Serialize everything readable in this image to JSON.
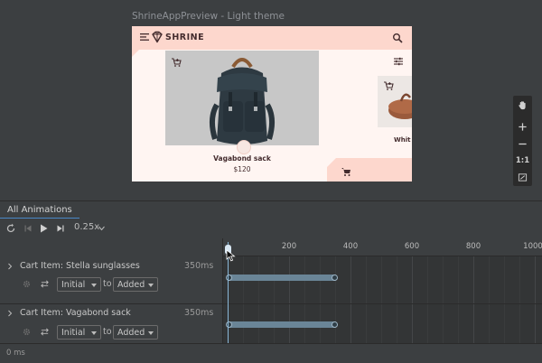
{
  "preview": {
    "title": "ShrineAppPreview - Light theme",
    "app": {
      "brand": "SHRINE",
      "icons": [
        "menu-icon",
        "shrine-logo-icon",
        "search-icon",
        "filter-icon",
        "add-shopping-cart-icon",
        "shopping-cart-icon"
      ],
      "products": [
        {
          "name": "Vagabond sack",
          "price": "$120"
        },
        {
          "name": "Whit"
        }
      ],
      "colors": {
        "appbar": "#fdd7cd",
        "surface": "#fff5f2",
        "text": "#442c2e"
      }
    },
    "toolbar": {
      "items": [
        "pan-icon",
        "zoom-in-icon",
        "zoom-out-icon",
        "1:1",
        "fit-screen-icon"
      ],
      "fit_label": "1:1"
    }
  },
  "tabs": [
    {
      "label": "All Animations",
      "selected": true
    }
  ],
  "controls": {
    "speed": "0.25x",
    "icons": [
      "replay-icon",
      "skip-start-icon",
      "play-icon",
      "skip-end-icon"
    ]
  },
  "timeline": {
    "ruler_labels": [
      "200",
      "400",
      "600",
      "800",
      "1000"
    ],
    "rows": [
      {
        "title": "Cart Item: Stella sunglasses",
        "duration": "350ms",
        "from": "Initial",
        "to_label": "to",
        "to": "Added"
      },
      {
        "title": "Cart Item: Vagabond sack",
        "duration": "350ms",
        "from": "Initial",
        "to_label": "to",
        "to": "Added"
      }
    ],
    "accent": "#4a88c7",
    "bar_color": "#6a8597"
  },
  "footer": {
    "time": "0 ms"
  }
}
